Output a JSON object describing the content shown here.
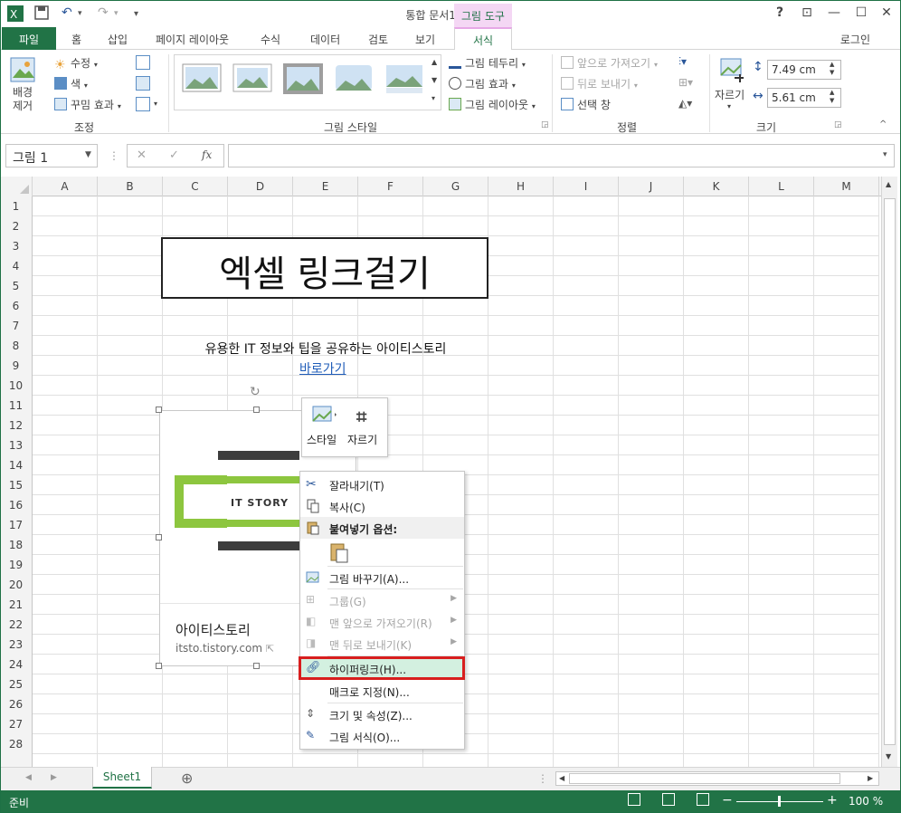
{
  "app": {
    "title": "통합 문서1 - Excel",
    "tools_header": "그림 도구"
  },
  "window": {
    "help": "?",
    "restore_ribbon": "⊡",
    "minimize": "—",
    "maximize": "☐",
    "close": "✕"
  },
  "tabs": {
    "file": "파일",
    "items": [
      "홈",
      "삽입",
      "페이지 레이아웃",
      "수식",
      "데이터",
      "검토",
      "보기"
    ],
    "format": "서식",
    "login": "로그인"
  },
  "ribbon": {
    "adjust": {
      "remove_bg": "배경\n제거",
      "correct": "수정",
      "color": "색",
      "effects": "꾸밈 효과",
      "label": "조정"
    },
    "styles": {
      "border": "그림 테두리",
      "effects": "그림 효과",
      "layout": "그림 레이아웃",
      "label": "그림 스타일"
    },
    "arrange": {
      "bring_forward": "앞으로 가져오기",
      "send_back": "뒤로 보내기",
      "selection": "선택 창",
      "label": "정렬"
    },
    "size": {
      "crop": "자르기",
      "height": "7.49 cm",
      "width": "5.61 cm",
      "label": "크기"
    }
  },
  "formula_bar": {
    "name_box": "그림 1",
    "fx": "fx",
    "cancel": "✕",
    "enter": "✓"
  },
  "columns": [
    "A",
    "B",
    "C",
    "D",
    "E",
    "F",
    "G",
    "H",
    "I",
    "J",
    "K",
    "L",
    "M"
  ],
  "rows": [
    "1",
    "2",
    "3",
    "4",
    "5",
    "6",
    "7",
    "8",
    "9",
    "10",
    "11",
    "12",
    "13",
    "14",
    "15",
    "16",
    "17",
    "18",
    "19",
    "20",
    "21",
    "22",
    "23",
    "24",
    "25",
    "26",
    "27",
    "28"
  ],
  "content": {
    "title": "엑셀 링크걸기",
    "desc": "유용한 IT 정보와 팁을 공유하는 아이티스토리",
    "link": "바로가기"
  },
  "picture": {
    "logo_text": "IT STORY",
    "name": "아이티스토리",
    "url": "itsto.tistory.com"
  },
  "minibar": {
    "style": "스타일",
    "crop": "자르기"
  },
  "context_menu": {
    "cut": "잘라내기(T)",
    "copy": "복사(C)",
    "paste_options": "붙여넣기 옵션:",
    "change_picture": "그림 바꾸기(A)...",
    "group": "그룹(G)",
    "bring_front": "맨 앞으로 가져오기(R)",
    "send_back": "맨 뒤로 보내기(K)",
    "hyperlink": "하이퍼링크(H)...",
    "assign_macro": "매크로 지정(N)...",
    "size_props": "크기 및 속성(Z)...",
    "format_picture": "그림 서식(O)..."
  },
  "sheet": {
    "tab": "Sheet1",
    "add": "⊕"
  },
  "status": {
    "ready": "준비",
    "zoom": "100 %"
  },
  "colors": {
    "excel_green": "#217346",
    "highlight": "#d81e1e",
    "logo_green": "#8dc63f",
    "logo_dark": "#3d3d3d"
  }
}
